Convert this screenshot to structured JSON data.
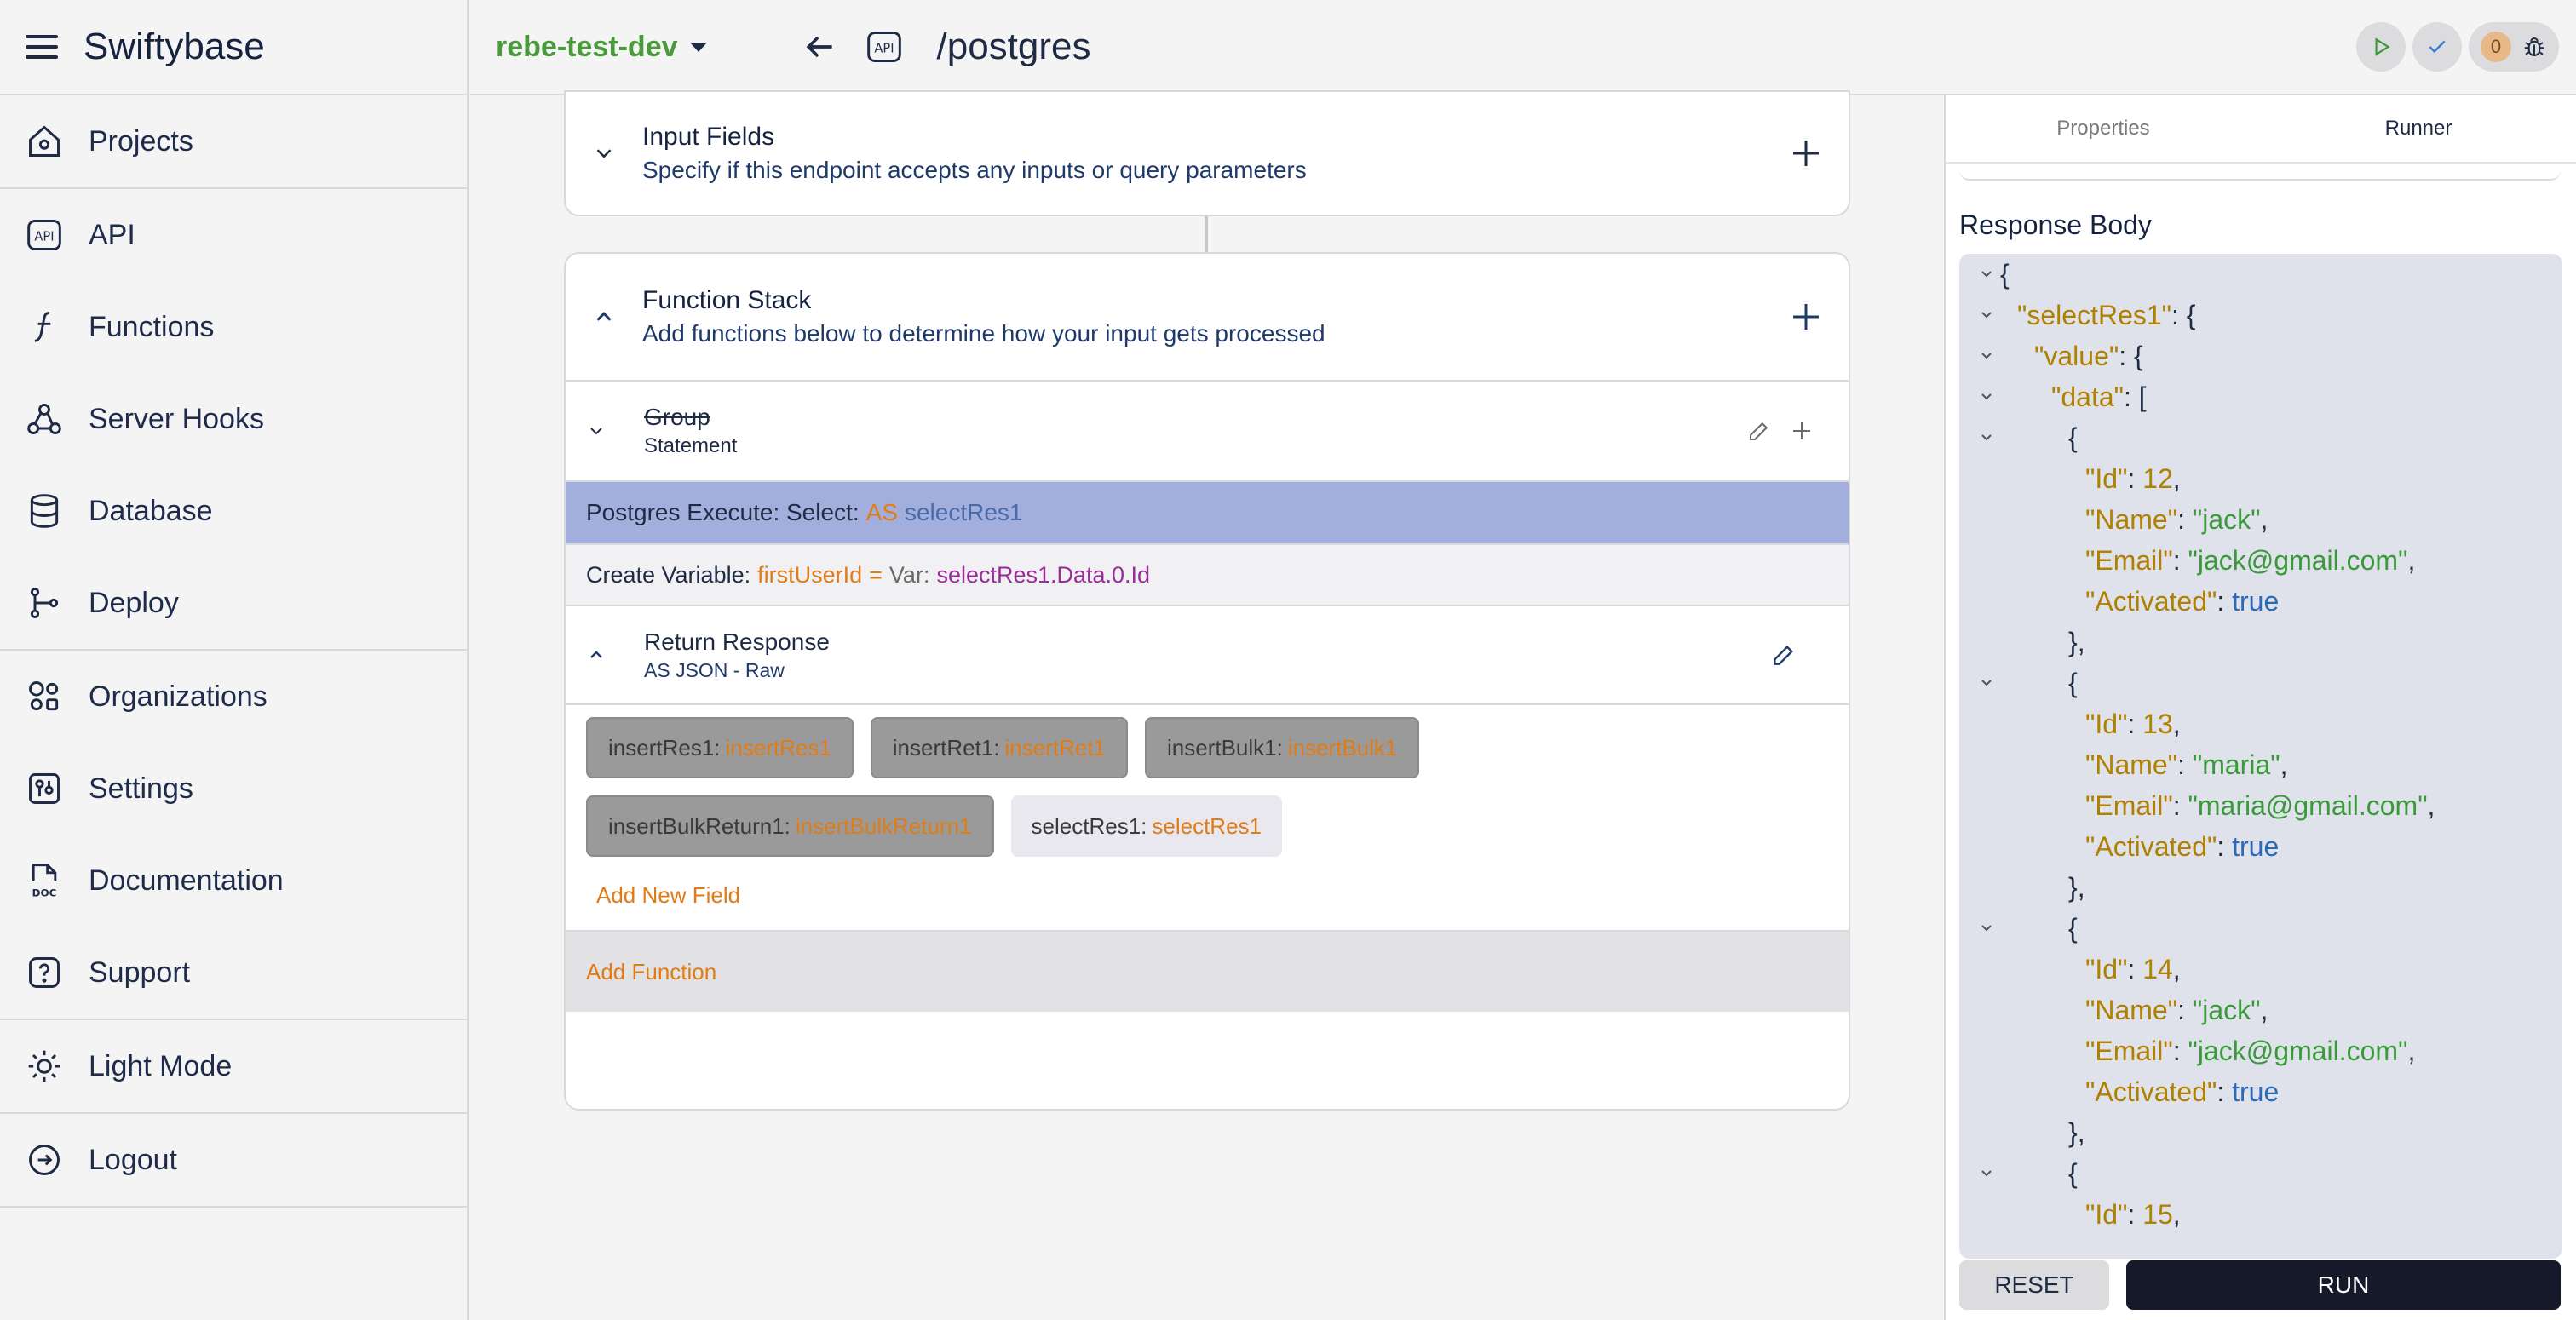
{
  "app": {
    "name": "Swiftybase"
  },
  "sidebar": {
    "items": [
      {
        "label": "Projects",
        "icon": "home-icon"
      },
      {
        "label": "API",
        "icon": "api-icon"
      },
      {
        "label": "Functions",
        "icon": "function-icon"
      },
      {
        "label": "Server Hooks",
        "icon": "webhook-icon"
      },
      {
        "label": "Database",
        "icon": "database-icon"
      },
      {
        "label": "Deploy",
        "icon": "git-branch-icon"
      },
      {
        "label": "Organizations",
        "icon": "organizations-icon"
      },
      {
        "label": "Settings",
        "icon": "settings-icon"
      },
      {
        "label": "Documentation",
        "icon": "doc-icon"
      },
      {
        "label": "Support",
        "icon": "help-icon"
      },
      {
        "label": "Light Mode",
        "icon": "sun-icon"
      },
      {
        "label": "Logout",
        "icon": "logout-icon"
      }
    ]
  },
  "topbar": {
    "environment": "rebe-test-dev",
    "path": "/postgres",
    "api_badge": "API",
    "debug_count": "0"
  },
  "input_fields": {
    "title": "Input Fields",
    "subtitle": "Specify if this endpoint accepts any inputs or query parameters"
  },
  "function_stack": {
    "title": "Function Stack",
    "subtitle": "Add functions below to determine how your input gets processed",
    "group": {
      "title": "Group",
      "subtitle": "Statement"
    },
    "postgres_row": {
      "prefix": "Postgres Execute: Select:",
      "as": "AS",
      "var": "selectRes1"
    },
    "create_var_row": {
      "prefix": "Create Variable:",
      "name": "firstUserId",
      "eq": "=",
      "var_label": "Var:",
      "value": "selectRes1.Data.0.Id"
    },
    "return_response": {
      "title": "Return Response",
      "subtitle": "AS JSON - Raw"
    },
    "fields": [
      {
        "key": "insertRes1:",
        "value": "insertRes1"
      },
      {
        "key": "insertRet1:",
        "value": "insertRet1"
      },
      {
        "key": "insertBulk1:",
        "value": "insertBulk1"
      },
      {
        "key": "insertBulkReturn1:",
        "value": "insertBulkReturn1"
      },
      {
        "key": "selectRes1:",
        "value": "selectRes1"
      }
    ],
    "add_new_field": "Add New Field",
    "add_function": "Add Function"
  },
  "right_panel": {
    "tabs": [
      "Properties",
      "Runner"
    ],
    "response_title": "Response Body",
    "reset": "RESET",
    "run": "RUN"
  },
  "response_json": {
    "root_key": "\"selectRes1\"",
    "value_key": "\"value\"",
    "data_key": "\"data\"",
    "records": [
      {
        "id": "12",
        "name": "\"jack\"",
        "email": "\"jack@gmail.com\"",
        "activated": "true"
      },
      {
        "id": "13",
        "name": "\"maria\"",
        "email": "\"maria@gmail.com\"",
        "activated": "true"
      },
      {
        "id": "14",
        "name": "\"jack\"",
        "email": "\"jack@gmail.com\"",
        "activated": "true"
      },
      {
        "id": "15"
      }
    ],
    "labels": {
      "id": "\"Id\"",
      "name": "\"Name\"",
      "email": "\"Email\"",
      "activated": "\"Activated\""
    }
  },
  "colors": {
    "env_green": "#4a9a3c",
    "accent_orange": "#e07b16",
    "selected_row": "#a2afdd",
    "run_dark": "#16192a"
  }
}
